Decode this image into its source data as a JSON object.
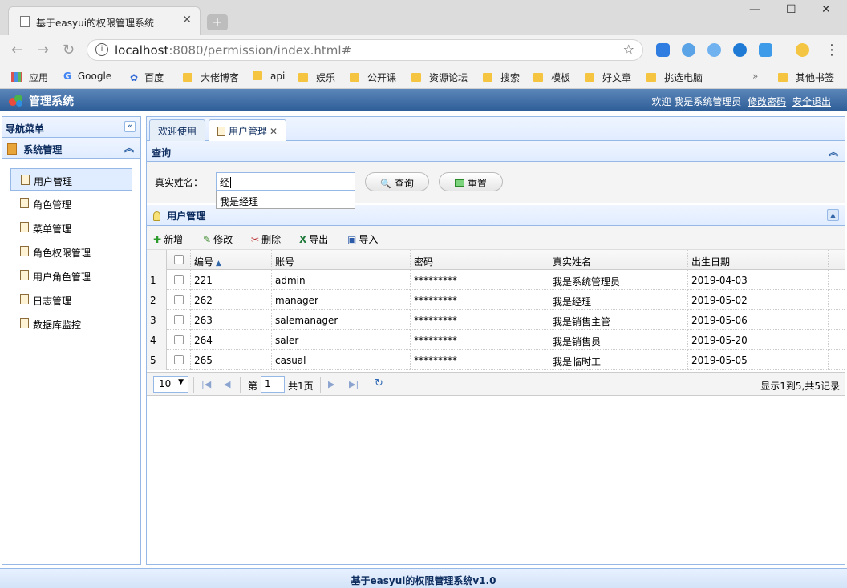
{
  "browser": {
    "tab_title": "基于easyui的权限管理系统",
    "url_host": "localhost",
    "url_rest": ":8080/permission/index.html#",
    "bookmarks": [
      "应用",
      "Google",
      "百度",
      "大佬博客",
      "api",
      "娱乐",
      "公开课",
      "资源论坛",
      "搜索",
      "模板",
      "好文章",
      "挑选电脑",
      "»",
      "其他书签"
    ]
  },
  "header": {
    "title": "管理系统",
    "welcome": "欢迎 我是系统管理员",
    "change_pwd": "修改密码",
    "logout": "安全退出"
  },
  "nav": {
    "title": "导航菜单",
    "section": "系统管理",
    "items": [
      "用户管理",
      "角色管理",
      "菜单管理",
      "角色权限管理",
      "用户角色管理",
      "日志管理",
      "数据库监控"
    ]
  },
  "tabs": [
    "欢迎使用",
    "用户管理"
  ],
  "query": {
    "title": "查询",
    "label": "真实姓名：",
    "value": "经",
    "suggestion": "我是经理",
    "search_btn": "查询",
    "reset_btn": "重置"
  },
  "users": {
    "title": "用户管理",
    "toolbar": [
      "新增",
      "修改",
      "删除",
      "导出",
      "导入"
    ],
    "columns": [
      "编号",
      "账号",
      "密码",
      "真实姓名",
      "出生日期"
    ],
    "rows": [
      {
        "n": "1",
        "id": "221",
        "account": "admin",
        "pwd": "*********",
        "name": "我是系统管理员",
        "birth": "2019-04-03"
      },
      {
        "n": "2",
        "id": "262",
        "account": "manager",
        "pwd": "*********",
        "name": "我是经理",
        "birth": "2019-05-02"
      },
      {
        "n": "3",
        "id": "263",
        "account": "salemanager",
        "pwd": "*********",
        "name": "我是销售主管",
        "birth": "2019-05-06"
      },
      {
        "n": "4",
        "id": "264",
        "account": "saler",
        "pwd": "*********",
        "name": "我是销售员",
        "birth": "2019-05-20"
      },
      {
        "n": "5",
        "id": "265",
        "account": "casual",
        "pwd": "*********",
        "name": "我是临时工",
        "birth": "2019-05-05"
      }
    ],
    "pager": {
      "size": "10",
      "page_prefix": "第",
      "page": "1",
      "page_suffix": "共1页",
      "summary": "显示1到5,共5记录"
    }
  },
  "footer": "基于easyui的权限管理系统v1.0"
}
